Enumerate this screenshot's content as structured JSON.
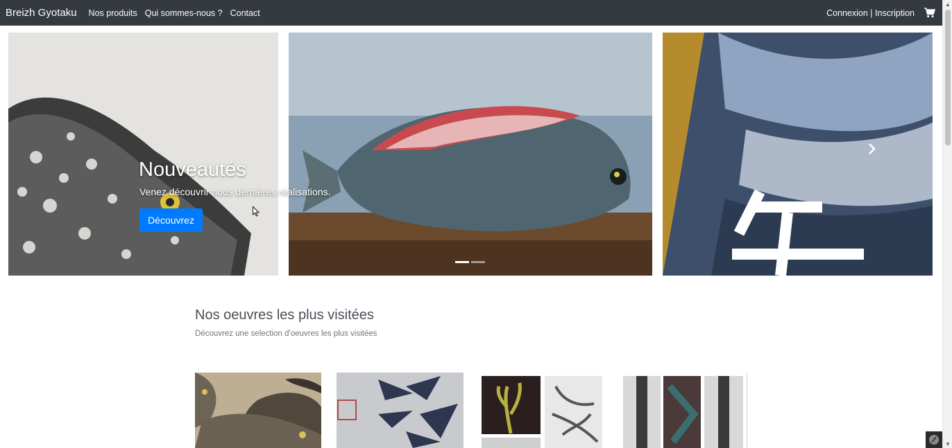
{
  "navbar": {
    "brand": "Breizh Gyotaku",
    "links": [
      "Nos produits",
      "Qui sommes-nous ?",
      "Contact"
    ],
    "auth": "Connexion | Inscription",
    "cart_icon": "shopping-cart-icon"
  },
  "carousel": {
    "title": "Nouveautés",
    "text": "Venez découvrir nous dernières réalisations.",
    "button": "Découvrez",
    "next_icon": "chevron-right-icon",
    "slide_count": 3,
    "active_slide": 1
  },
  "section": {
    "title": "Nos oeuvres les plus visitées",
    "subtitle": "Découvrez une selection d'oeuvres les plus visitées"
  },
  "cards": [
    "fish-print-artwork",
    "bird-print-artwork",
    "seaweed-print-artwork",
    "fish-triptych-artwork"
  ],
  "colors": {
    "navbar": "#343a40",
    "accent": "#007bff"
  }
}
